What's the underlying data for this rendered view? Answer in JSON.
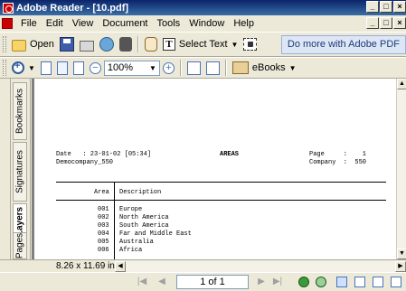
{
  "window": {
    "title": "Adobe Reader - [10.pdf]",
    "controls": [
      "_",
      "□",
      "×"
    ],
    "doc_controls": [
      "_",
      "□",
      "×"
    ]
  },
  "menu": [
    {
      "label": "File",
      "key": "F"
    },
    {
      "label": "Edit",
      "key": "E"
    },
    {
      "label": "View",
      "key": "V"
    },
    {
      "label": "Document",
      "key": "D"
    },
    {
      "label": "Tools",
      "key": "T"
    },
    {
      "label": "Window",
      "key": "W"
    },
    {
      "label": "Help",
      "key": "H"
    }
  ],
  "toolbar": {
    "open_label": "Open",
    "select_text_label": "Select Text",
    "promo_label": "Do more with Adobe PDF",
    "zoom_value": "100%",
    "ebooks_label": "eBooks"
  },
  "nav_tabs": [
    "Bookmarks",
    "Signatures",
    "Layers",
    "Pages"
  ],
  "document": {
    "header_left_1": "Date   : 23-01-02 [05:34]",
    "header_left_2": "Democompany_550",
    "header_center": "AREAS",
    "header_right_1": "Page     :    1",
    "header_right_2": "Company  :  550",
    "col_area": "Area",
    "col_description": "Description",
    "rows": [
      {
        "code": "001",
        "desc": "Europe"
      },
      {
        "code": "002",
        "desc": "North America"
      },
      {
        "code": "003",
        "desc": "South America"
      },
      {
        "code": "004",
        "desc": "Far and Middle East"
      },
      {
        "code": "005",
        "desc": "Australia"
      },
      {
        "code": "006",
        "desc": "Africa"
      }
    ]
  },
  "status": {
    "page_size": "8.26 x 11.69 in",
    "page_indicator": "1 of 1"
  },
  "icons": [
    "app-icon",
    "folder-open-icon",
    "save-icon",
    "print-icon",
    "email-icon",
    "search-icon",
    "hand-tool-icon",
    "select-text-icon",
    "snapshot-icon",
    "zoom-in-icon",
    "actual-size-icon",
    "fit-page-icon",
    "fit-width-icon",
    "zoom-out-icon",
    "rotate-icon",
    "ebook-icon",
    "first-page-icon",
    "previous-page-icon",
    "next-page-icon",
    "last-page-icon",
    "go-back-icon",
    "go-forward-icon",
    "single-page-icon",
    "continuous-icon",
    "facing-icon"
  ]
}
